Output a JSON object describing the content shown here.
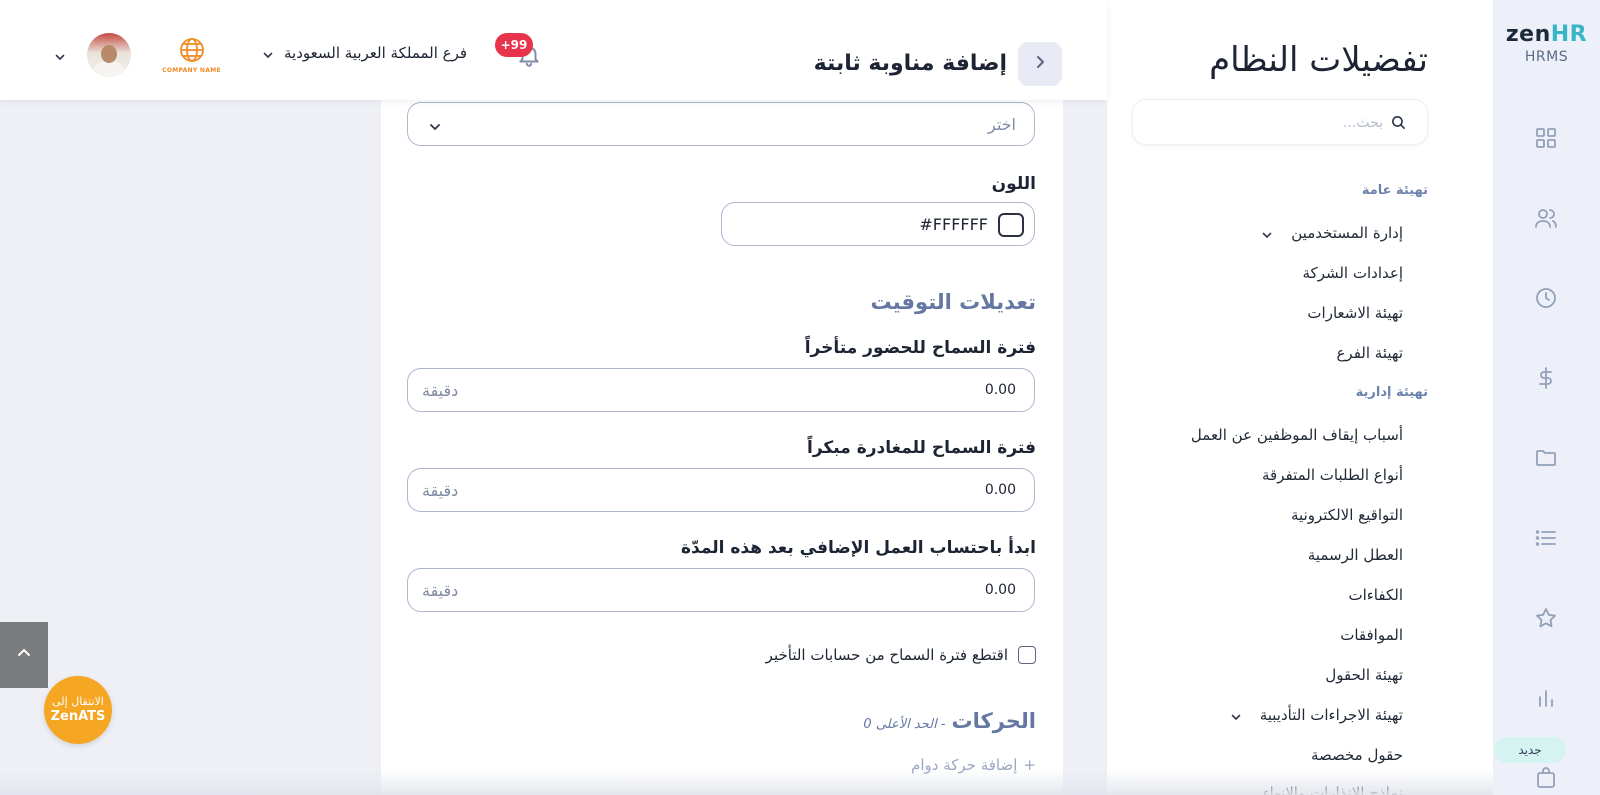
{
  "brand": {
    "name_main": "zen",
    "name_accent": "HR",
    "product": "HRMS"
  },
  "rail": {
    "icons": [
      "grid-icon",
      "users-icon",
      "clock-icon",
      "dollar-icon",
      "folder-icon",
      "list-icon",
      "star-icon",
      "bar-chart-icon",
      "bag-icon"
    ],
    "new_badge": "جديد"
  },
  "settings": {
    "title": "تفضيلات النظام",
    "search_placeholder": "بحث...",
    "sections": [
      {
        "label": "تهيئة عامة",
        "items": [
          {
            "label": "إدارة المستخدمين",
            "has_chevron": true
          },
          {
            "label": "إعدادات الشركة"
          },
          {
            "label": "تهيئة الاشعارات"
          },
          {
            "label": "تهيئة الفرع"
          }
        ]
      },
      {
        "label": "تهيئة إدارية",
        "items": [
          {
            "label": "أسباب إيقاف الموظفين عن العمل"
          },
          {
            "label": "أنواع الطلبات المتفرقة"
          },
          {
            "label": "التواقيع الالكترونية"
          },
          {
            "label": "العطل الرسمية"
          },
          {
            "label": "الكفاءات"
          },
          {
            "label": "الموافقات"
          },
          {
            "label": "تهيئة الحقول"
          },
          {
            "label": "تهيئة الاجراءات التأديبية",
            "has_chevron": true
          },
          {
            "label": "حقول مخصصة"
          },
          {
            "label": "نماذج الانذارات والانهاء"
          }
        ]
      }
    ]
  },
  "header": {
    "title": "إضافة مناوبة ثابتة",
    "notifications": "+99",
    "branch": "فرع المملكة العربية السعودية",
    "company_logo_text": "COMPANY NAME"
  },
  "form": {
    "select_value": "اختر",
    "color_label": "اللون",
    "color_value": "#FFFFFF",
    "timing_heading": "تعديلات التوقيت",
    "fields": [
      {
        "label": "فترة السماح للحضور متأخراً",
        "value": "0.00",
        "unit": "دقيقة"
      },
      {
        "label": "فترة السماح للمغادرة مبكراً",
        "value": "0.00",
        "unit": "دقيقة"
      },
      {
        "label": "ابدأ باحتساب العمل الإضافي بعد هذه المدّة",
        "value": "0.00",
        "unit": "دقيقة"
      }
    ],
    "deduct_checkbox": {
      "label": "اقتطع فترة السماح من حسابات التأخير",
      "checked": false
    },
    "moves_heading": "الحركات",
    "moves_sub": "- الحد الأعلى 0",
    "add_move": "إضافة حركة دوام"
  },
  "floating": {
    "zenats_line1": "الانتقال إلى",
    "zenats_line2": "ZenATS"
  }
}
